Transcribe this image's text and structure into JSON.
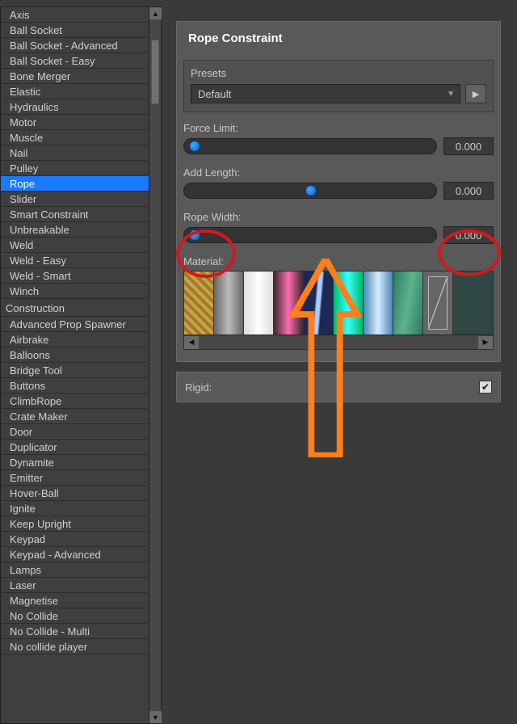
{
  "sidebar": {
    "items_top": [
      "Axis",
      "Ball Socket",
      "Ball Socket - Advanced",
      "Ball Socket - Easy",
      "Bone Merger",
      "Elastic",
      "Hydraulics",
      "Motor",
      "Muscle",
      "Nail",
      "Pulley",
      "Rope",
      "Slider",
      "Smart Constraint",
      "Unbreakable",
      "Weld",
      "Weld - Easy",
      "Weld - Smart",
      "Winch"
    ],
    "selected_index": 11,
    "group2_header": "Construction",
    "items_bottom": [
      "Advanced Prop Spawner",
      "Airbrake",
      "Balloons",
      "Bridge Tool",
      "Buttons",
      "ClimbRope",
      "Crate Maker",
      "Door",
      "Duplicator",
      "Dynamite",
      "Emitter",
      "Hover-Ball",
      "Ignite",
      "Keep Upright",
      "Keypad",
      "Keypad - Advanced",
      "Lamps",
      "Laser",
      "Magnetise",
      "No Collide",
      "No Collide - Multi",
      "No collide player"
    ]
  },
  "panel": {
    "title": "Rope Constraint",
    "presets_label": "Presets",
    "preset_value": "Default",
    "force_label": "Force Limit:",
    "force_value": "0.000",
    "force_knob_pct": 2,
    "addlen_label": "Add Length:",
    "addlen_value": "0.000",
    "addlen_knob_pct": 48,
    "width_label": "Rope Width:",
    "width_value": "0.000",
    "width_knob_pct": 2,
    "material_label": "Material:",
    "materials": [
      "rope",
      "metal",
      "white",
      "pink",
      "lightning",
      "cyan",
      "blue",
      "green",
      "frame",
      "dark"
    ]
  },
  "rigid": {
    "label": "Rigid:",
    "checked": true
  }
}
